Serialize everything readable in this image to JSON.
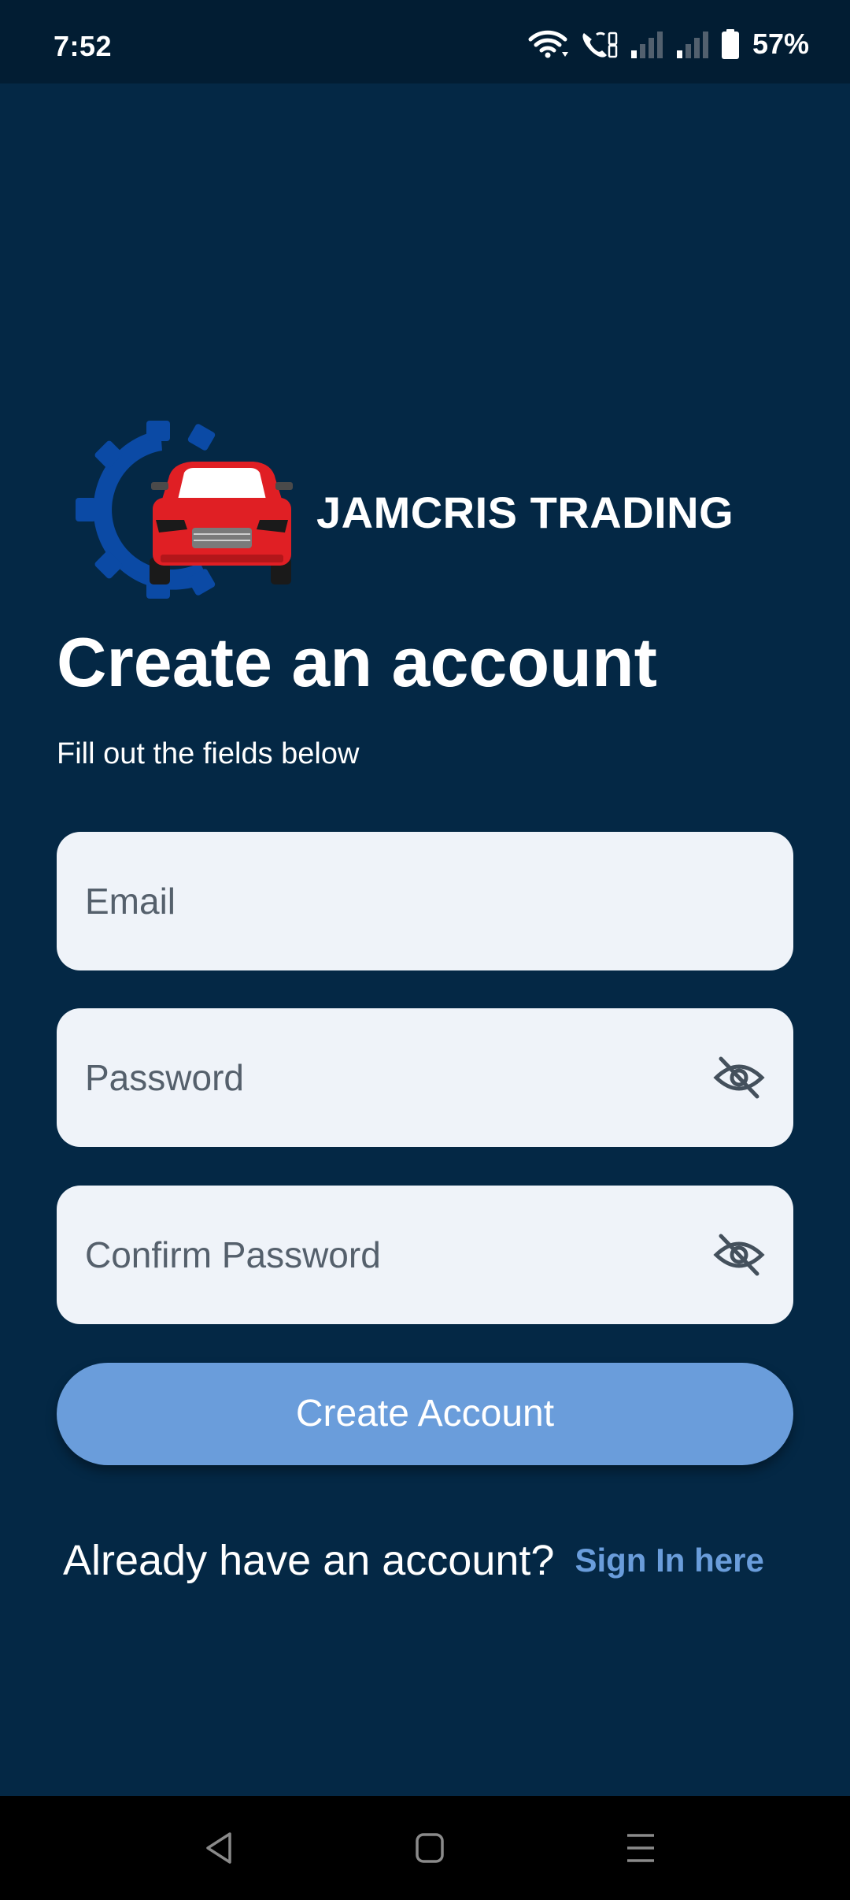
{
  "status_bar": {
    "time": "7:52",
    "battery": "57%",
    "icons": [
      "wifi-icon",
      "volte-call-icon",
      "signal-icon",
      "signal-icon",
      "battery-icon"
    ]
  },
  "logo": {
    "brand_name": "JAMCRIS TRADING",
    "gear_color": "#0b4aa5",
    "car_color": "#e01f24"
  },
  "header": {
    "title": "Create an account",
    "subtitle": "Fill out the fields below"
  },
  "form": {
    "email_placeholder": "Email",
    "password_placeholder": "Password",
    "confirm_placeholder": "Confirm Password",
    "visibility_icon": "eye-off-icon",
    "submit_label": "Create Account"
  },
  "footer": {
    "prompt": "Already have an account?",
    "link": "Sign In here"
  },
  "nav_bar": {
    "buttons": [
      "back-icon",
      "home-icon",
      "recents-icon"
    ]
  },
  "colors": {
    "background": "#042845",
    "field_background": "#eff3f9",
    "accent": "#6a9ddb"
  }
}
